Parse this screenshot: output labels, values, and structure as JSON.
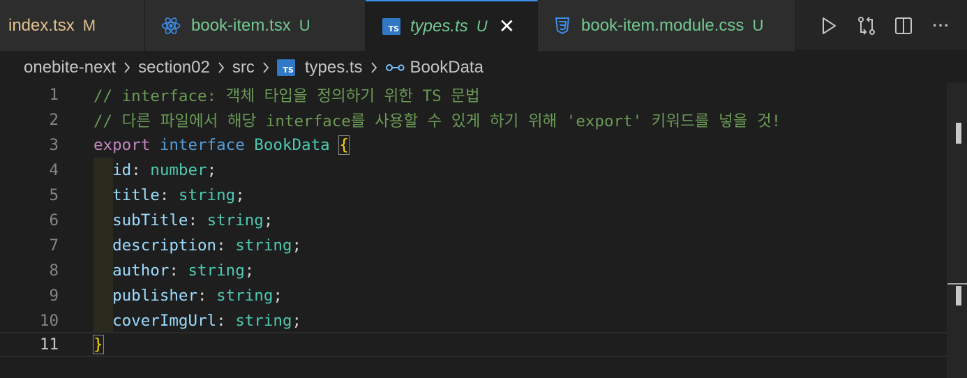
{
  "tabs": [
    {
      "label": "index.tsx",
      "status": "M",
      "icon": "none"
    },
    {
      "label": "book-item.tsx",
      "status": "U",
      "icon": "react-icon"
    },
    {
      "label": "types.ts",
      "status": "U",
      "icon": "typescript-icon",
      "badge": "TS",
      "active": true
    },
    {
      "label": "book-item.module.css",
      "status": "U",
      "icon": "css-icon"
    }
  ],
  "close_glyph": "✕",
  "actions": [
    "run-icon",
    "compare-changes-icon",
    "split-editor-icon",
    "more-actions-icon"
  ],
  "more_glyph": "···",
  "breadcrumb": {
    "items": [
      "onebite-next",
      "section02",
      "src",
      "types.ts",
      "BookData"
    ],
    "file_badge": "TS"
  },
  "editor": {
    "line_numbers": [
      "1",
      "2",
      "3",
      "4",
      "5",
      "6",
      "7",
      "8",
      "9",
      "10",
      "11"
    ],
    "current_line": 11,
    "lines": {
      "l1": "// interface: 객체 타입을 정의하기 위한 TS 문법",
      "l2": "// 다른 파일에서 해당 interface를 사용할 수 있게 하기 위해 'export' 키워드를 넣을 것!",
      "l3_kw": "export",
      "l3_kw2": "interface",
      "l3_name": "BookData",
      "l3_brace": "{",
      "props": [
        {
          "name": "id",
          "type": "number"
        },
        {
          "name": "title",
          "type": "string"
        },
        {
          "name": "subTitle",
          "type": "string"
        },
        {
          "name": "description",
          "type": "string"
        },
        {
          "name": "author",
          "type": "string"
        },
        {
          "name": "publisher",
          "type": "string"
        },
        {
          "name": "coverImgUrl",
          "type": "string"
        }
      ],
      "colon": ":",
      "semicolon": ";",
      "l11_brace": "}"
    }
  },
  "colors": {
    "modified": "#e2c08d",
    "untracked": "#73c991",
    "accent": "#3b8eea",
    "comment": "#6a9955",
    "keyword": "#c586c0",
    "storage": "#569cd6",
    "type": "#4ec9b0",
    "property": "#9cdcfe"
  }
}
